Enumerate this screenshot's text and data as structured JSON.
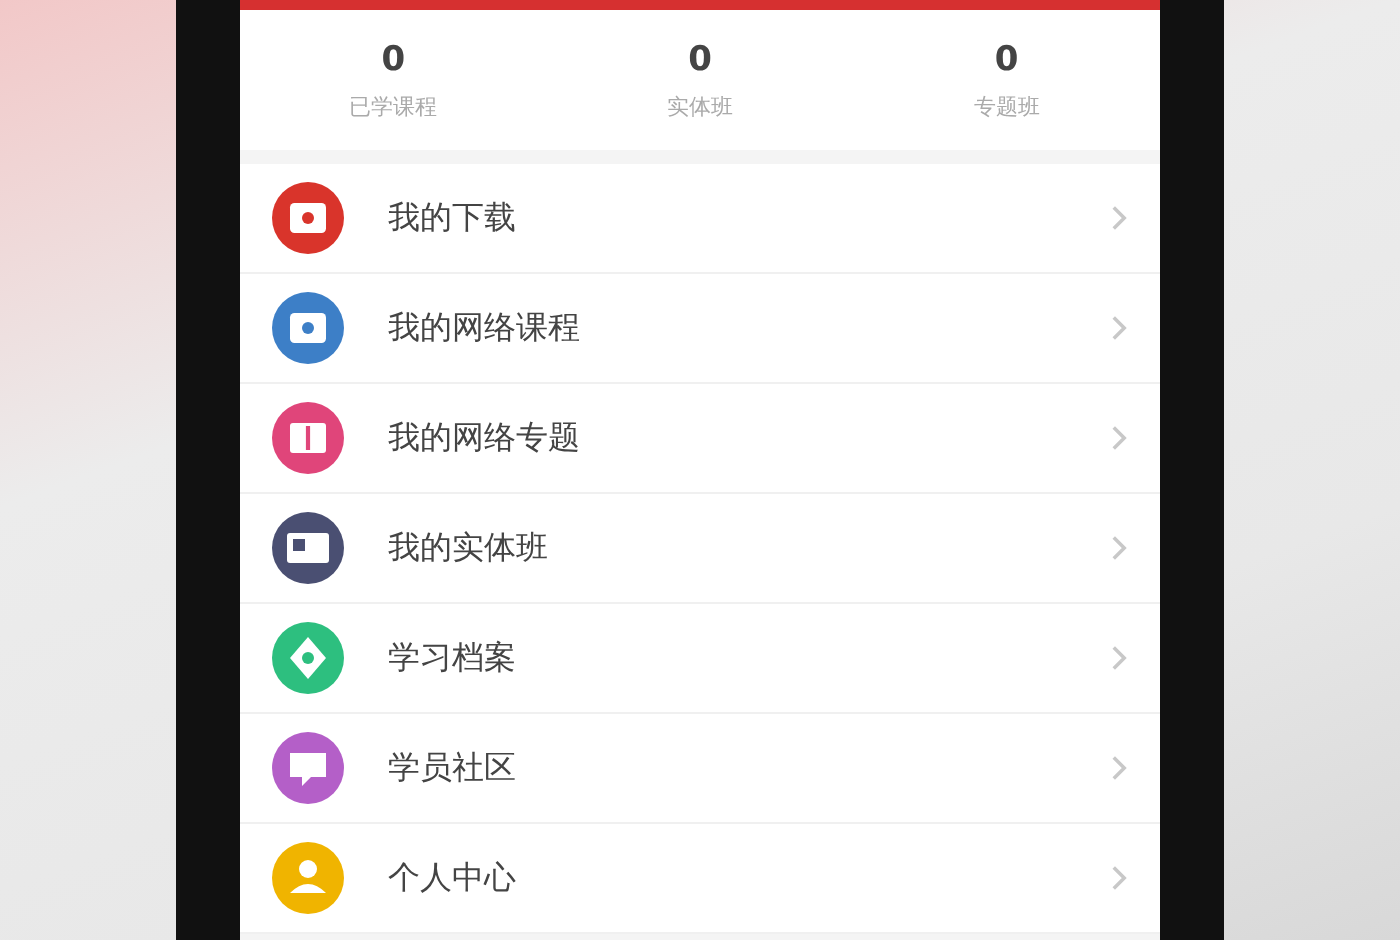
{
  "stats": [
    {
      "value": "0",
      "label": "已学课程"
    },
    {
      "value": "0",
      "label": "实体班"
    },
    {
      "value": "0",
      "label": "专题班"
    }
  ],
  "menu": [
    {
      "label": "我的下载",
      "color": "#d9342b",
      "kind": "screen"
    },
    {
      "label": "我的网络课程",
      "color": "#3d7fc7",
      "kind": "screen"
    },
    {
      "label": "我的网络专题",
      "color": "#e0457a",
      "kind": "book"
    },
    {
      "label": "我的实体班",
      "color": "#4a4f72",
      "kind": "card"
    },
    {
      "label": "学习档案",
      "color": "#2dbf7f",
      "kind": "badge"
    },
    {
      "label": "学员社区",
      "color": "#b45fc8",
      "kind": "chat"
    },
    {
      "label": "个人中心",
      "color": "#f0b400",
      "kind": "person"
    }
  ]
}
